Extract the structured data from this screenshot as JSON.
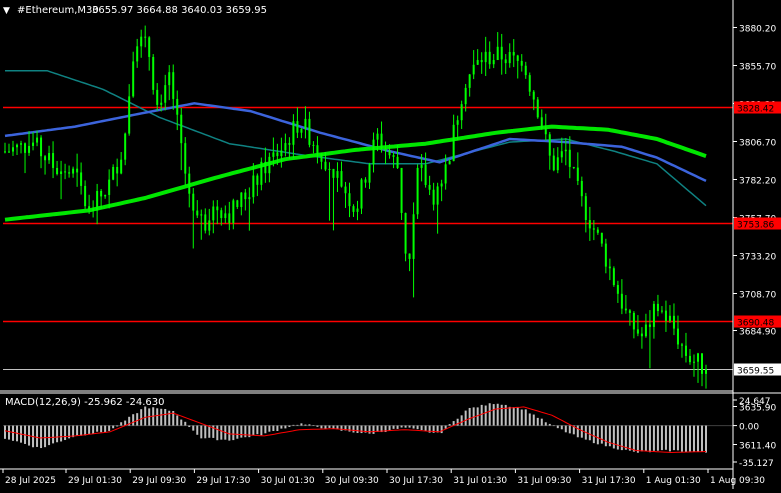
{
  "header": {
    "menu_arrow": "▼",
    "symbol_tf": "#Ethereum,M30",
    "ohlc": "3655.97 3664.88 3640.03 3659.95"
  },
  "price_axis": {
    "ticks": [
      "3880.20",
      "3855.70",
      "3831.30",
      "3806.70",
      "3782.20",
      "3757.70",
      "3733.20",
      "3708.70",
      "3684.90",
      "3659.55",
      "3635.90",
      "3611.40"
    ],
    "level_labels": [
      "3828.42",
      "3753.86",
      "3690.48"
    ],
    "current_label": "3659.55"
  },
  "macd": {
    "label": "MACD(12,26,9) -25.962 -24.630",
    "ticks": [
      "24.647",
      "0.00",
      "-35.127"
    ]
  },
  "time_axis": {
    "labels": [
      "28 Jul 2025",
      "29 Jul 01:30",
      "29 Jul 09:30",
      "29 Jul 17:30",
      "30 Jul 01:30",
      "30 Jul 09:30",
      "30 Jul 17:30",
      "31 Jul 01:30",
      "31 Jul 09:30",
      "31 Jul 17:30",
      "1 Aug 01:30",
      "1 Aug 09:30"
    ]
  },
  "colors": {
    "background": "#000000",
    "candle": "#00ff00",
    "grid": "#808080",
    "level_line": "#ff0000",
    "ma_fast": "#3c64dc",
    "ma_slow": "#00e600",
    "ma_teal": "#0f8282",
    "macd_hist": "#c0c0c0",
    "macd_signal": "#ff0000",
    "text": "#ffffff"
  },
  "chart_data": {
    "type": "candlestick",
    "symbol": "#Ethereum",
    "timeframe": "M30",
    "ylim": [
      3611.4,
      3892
    ],
    "levels": [
      3828.42,
      3753.86,
      3690.48
    ],
    "current_price": 3659.55,
    "close_path": [
      {
        "t": 0,
        "v": 3800
      },
      {
        "t": 0.04,
        "v": 3805
      },
      {
        "t": 0.07,
        "v": 3790
      },
      {
        "t": 0.1,
        "v": 3785
      },
      {
        "t": 0.12,
        "v": 3760
      },
      {
        "t": 0.15,
        "v": 3780
      },
      {
        "t": 0.17,
        "v": 3805
      },
      {
        "t": 0.185,
        "v": 3875
      },
      {
        "t": 0.205,
        "v": 3865
      },
      {
        "t": 0.22,
        "v": 3820
      },
      {
        "t": 0.235,
        "v": 3850
      },
      {
        "t": 0.26,
        "v": 3775
      },
      {
        "t": 0.285,
        "v": 3755
      },
      {
        "t": 0.3,
        "v": 3765
      },
      {
        "t": 0.32,
        "v": 3760
      },
      {
        "t": 0.35,
        "v": 3775
      },
      {
        "t": 0.37,
        "v": 3790
      },
      {
        "t": 0.4,
        "v": 3805
      },
      {
        "t": 0.42,
        "v": 3820
      },
      {
        "t": 0.45,
        "v": 3800
      },
      {
        "t": 0.48,
        "v": 3780
      },
      {
        "t": 0.5,
        "v": 3762
      },
      {
        "t": 0.53,
        "v": 3810
      },
      {
        "t": 0.56,
        "v": 3790
      },
      {
        "t": 0.575,
        "v": 3720
      },
      {
        "t": 0.59,
        "v": 3790
      },
      {
        "t": 0.61,
        "v": 3770
      },
      {
        "t": 0.63,
        "v": 3790
      },
      {
        "t": 0.655,
        "v": 3845
      },
      {
        "t": 0.68,
        "v": 3860
      },
      {
        "t": 0.71,
        "v": 3862
      },
      {
        "t": 0.74,
        "v": 3855
      },
      {
        "t": 0.76,
        "v": 3828
      },
      {
        "t": 0.78,
        "v": 3790
      },
      {
        "t": 0.8,
        "v": 3800
      },
      {
        "t": 0.82,
        "v": 3770
      },
      {
        "t": 0.85,
        "v": 3740
      },
      {
        "t": 0.87,
        "v": 3715
      },
      {
        "t": 0.89,
        "v": 3690
      },
      {
        "t": 0.91,
        "v": 3680
      },
      {
        "t": 0.93,
        "v": 3700
      },
      {
        "t": 0.95,
        "v": 3690
      },
      {
        "t": 0.97,
        "v": 3670
      },
      {
        "t": 1.0,
        "v": 3659.95
      }
    ],
    "ma_fast": [
      {
        "t": 0,
        "v": 3810
      },
      {
        "t": 0.1,
        "v": 3816
      },
      {
        "t": 0.2,
        "v": 3825
      },
      {
        "t": 0.27,
        "v": 3831
      },
      {
        "t": 0.35,
        "v": 3826
      },
      {
        "t": 0.45,
        "v": 3812
      },
      {
        "t": 0.55,
        "v": 3800
      },
      {
        "t": 0.62,
        "v": 3793
      },
      {
        "t": 0.72,
        "v": 3808
      },
      {
        "t": 0.8,
        "v": 3806
      },
      {
        "t": 0.88,
        "v": 3803
      },
      {
        "t": 0.93,
        "v": 3796
      },
      {
        "t": 1.0,
        "v": 3781
      }
    ],
    "ma_slow": [
      {
        "t": 0,
        "v": 3756
      },
      {
        "t": 0.12,
        "v": 3762
      },
      {
        "t": 0.2,
        "v": 3770
      },
      {
        "t": 0.3,
        "v": 3783
      },
      {
        "t": 0.4,
        "v": 3795
      },
      {
        "t": 0.5,
        "v": 3801
      },
      {
        "t": 0.6,
        "v": 3805
      },
      {
        "t": 0.7,
        "v": 3812
      },
      {
        "t": 0.78,
        "v": 3816
      },
      {
        "t": 0.86,
        "v": 3814
      },
      {
        "t": 0.93,
        "v": 3808
      },
      {
        "t": 1.0,
        "v": 3797
      }
    ],
    "ma_teal": [
      {
        "t": 0,
        "v": 3852
      },
      {
        "t": 0.06,
        "v": 3852
      },
      {
        "t": 0.14,
        "v": 3840
      },
      {
        "t": 0.22,
        "v": 3822
      },
      {
        "t": 0.32,
        "v": 3805
      },
      {
        "t": 0.42,
        "v": 3798
      },
      {
        "t": 0.52,
        "v": 3792
      },
      {
        "t": 0.6,
        "v": 3792
      },
      {
        "t": 0.72,
        "v": 3806
      },
      {
        "t": 0.8,
        "v": 3808
      },
      {
        "t": 0.87,
        "v": 3800
      },
      {
        "t": 0.93,
        "v": 3792
      },
      {
        "t": 1.0,
        "v": 3765
      }
    ],
    "macd": {
      "ylim": [
        -35.127,
        24.647
      ],
      "hist_path": [
        {
          "t": 0,
          "v": -12
        },
        {
          "t": 0.05,
          "v": -22
        },
        {
          "t": 0.1,
          "v": -10
        },
        {
          "t": 0.15,
          "v": -5
        },
        {
          "t": 0.2,
          "v": 18
        },
        {
          "t": 0.24,
          "v": 14
        },
        {
          "t": 0.28,
          "v": -12
        },
        {
          "t": 0.32,
          "v": -14
        },
        {
          "t": 0.37,
          "v": -8
        },
        {
          "t": 0.42,
          "v": 2
        },
        {
          "t": 0.47,
          "v": -4
        },
        {
          "t": 0.52,
          "v": -8
        },
        {
          "t": 0.57,
          "v": -2
        },
        {
          "t": 0.62,
          "v": -8
        },
        {
          "t": 0.66,
          "v": 16
        },
        {
          "t": 0.7,
          "v": 22
        },
        {
          "t": 0.74,
          "v": 16
        },
        {
          "t": 0.78,
          "v": 0
        },
        {
          "t": 0.82,
          "v": -12
        },
        {
          "t": 0.86,
          "v": -20
        },
        {
          "t": 0.9,
          "v": -26
        },
        {
          "t": 0.95,
          "v": -24
        },
        {
          "t": 1.0,
          "v": -26
        }
      ],
      "signal_path": [
        {
          "t": 0,
          "v": -5
        },
        {
          "t": 0.05,
          "v": -12
        },
        {
          "t": 0.1,
          "v": -10
        },
        {
          "t": 0.15,
          "v": -6
        },
        {
          "t": 0.2,
          "v": 8
        },
        {
          "t": 0.24,
          "v": 12
        },
        {
          "t": 0.28,
          "v": 2
        },
        {
          "t": 0.32,
          "v": -8
        },
        {
          "t": 0.37,
          "v": -10
        },
        {
          "t": 0.42,
          "v": -4
        },
        {
          "t": 0.47,
          "v": -3
        },
        {
          "t": 0.52,
          "v": -6
        },
        {
          "t": 0.57,
          "v": -4
        },
        {
          "t": 0.62,
          "v": -6
        },
        {
          "t": 0.66,
          "v": 6
        },
        {
          "t": 0.7,
          "v": 16
        },
        {
          "t": 0.74,
          "v": 18
        },
        {
          "t": 0.78,
          "v": 10
        },
        {
          "t": 0.82,
          "v": -4
        },
        {
          "t": 0.86,
          "v": -16
        },
        {
          "t": 0.9,
          "v": -24
        },
        {
          "t": 0.95,
          "v": -26
        },
        {
          "t": 1.0,
          "v": -25
        }
      ]
    }
  }
}
